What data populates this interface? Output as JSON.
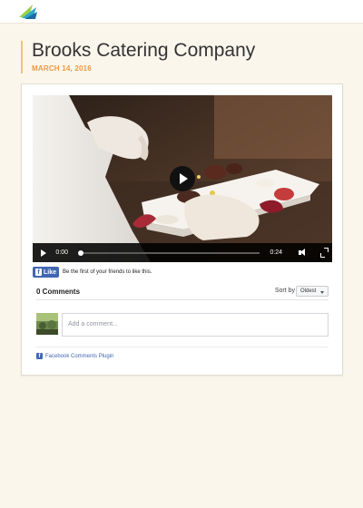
{
  "page": {
    "title": "Brooks Catering Company",
    "date": "MARCH 14, 2016"
  },
  "video": {
    "current_time": "0:00",
    "total_time": "0:24",
    "progress": 0
  },
  "facebook": {
    "like_label": "Like",
    "like_text": "Be the first of your friends to like this."
  },
  "comments": {
    "count_label": "0 Comments",
    "sort_label": "Sort by",
    "sort_value": "Oldest",
    "placeholder": "Add a comment...",
    "plugin_label": "Facebook Comments Plugin"
  },
  "icons": {
    "logo": "brand-logo-icon",
    "play": "play-icon",
    "volume": "volume-icon",
    "fullscreen": "fullscreen-icon",
    "facebook": "facebook-icon"
  },
  "colors": {
    "accent": "#f0993f",
    "facebook_blue": "#4267b2",
    "background": "#faf6ec"
  }
}
